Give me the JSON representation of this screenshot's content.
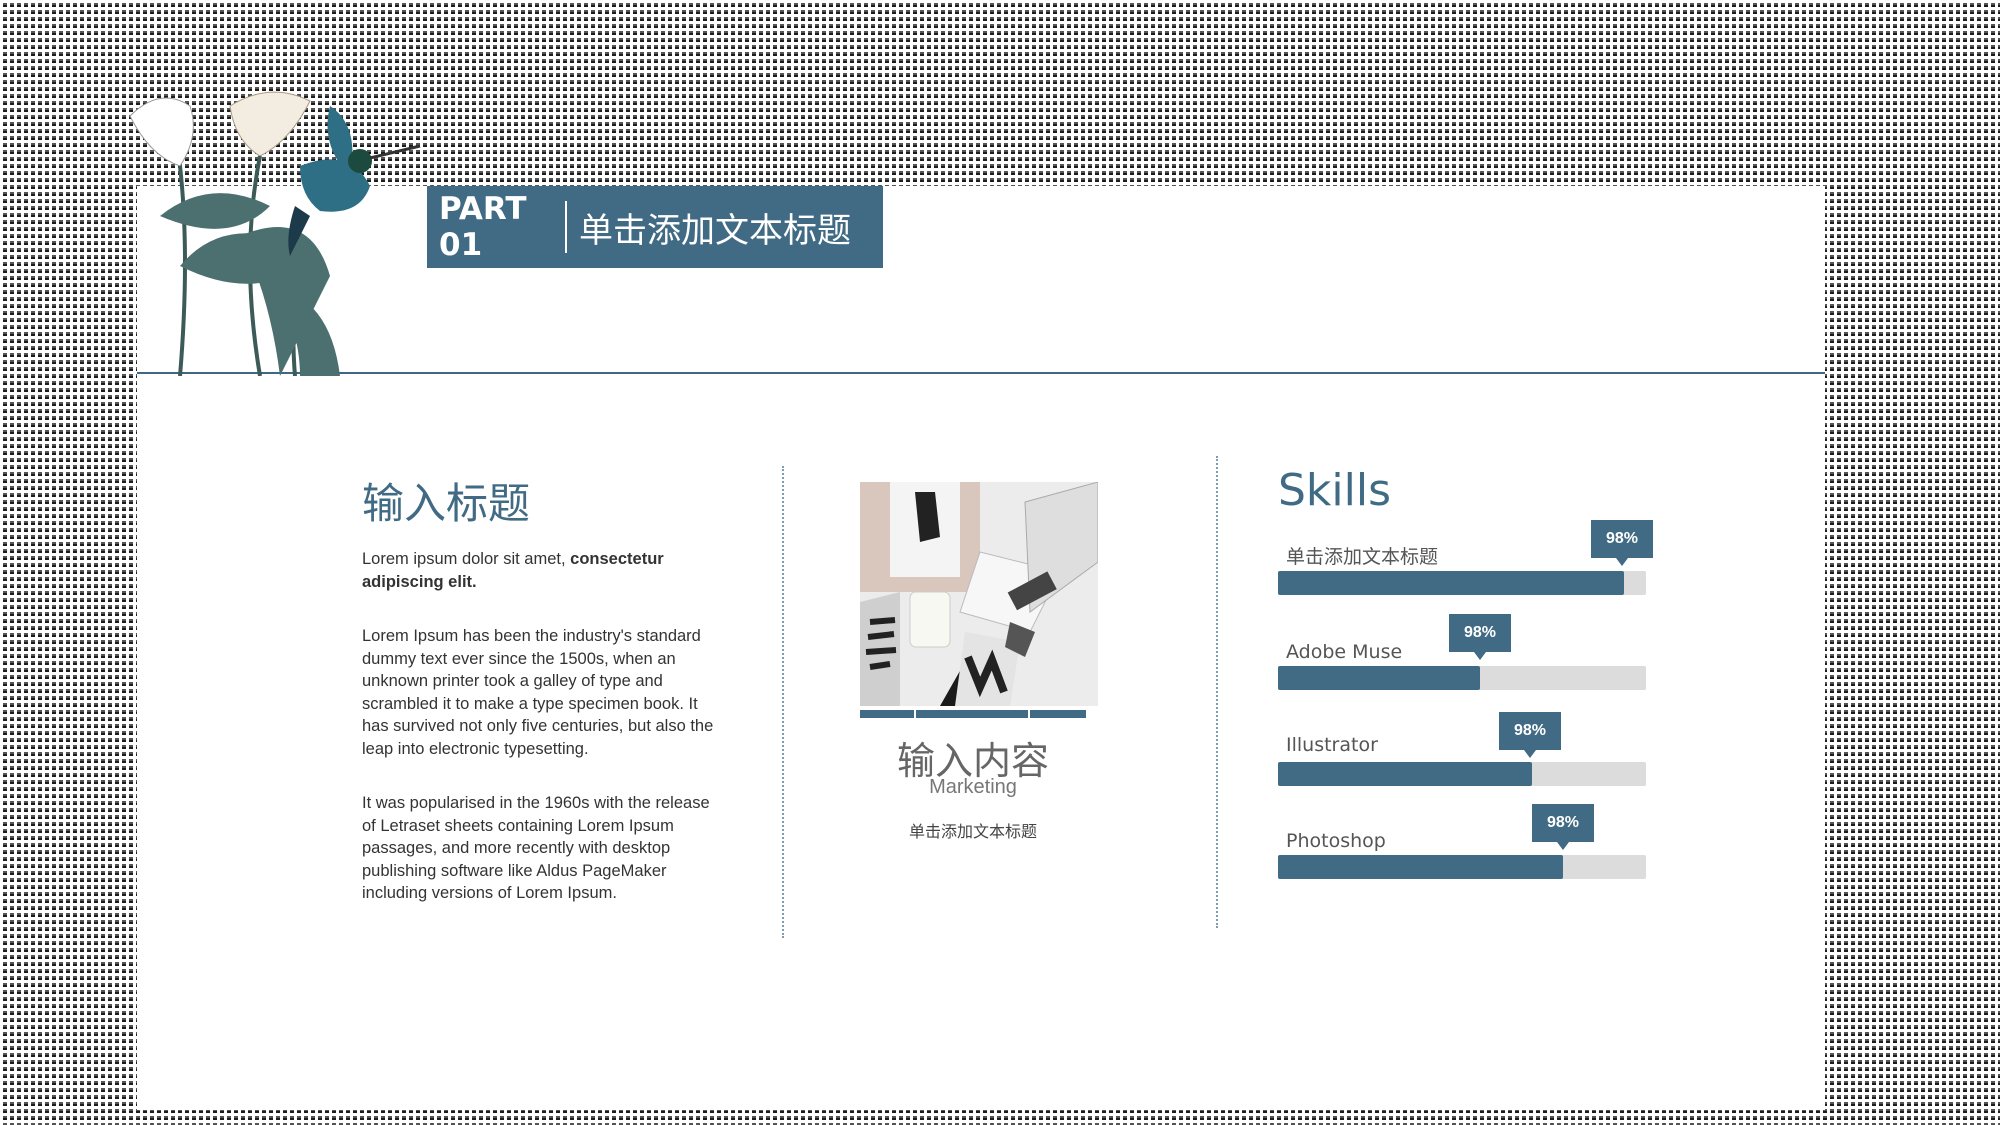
{
  "header": {
    "part_label": "PART 01",
    "title": "单击添加文本标题"
  },
  "left": {
    "title": "输入标题",
    "intro_plain": "Lorem ipsum dolor sit amet, ",
    "intro_bold": "consectetur adipiscing elit.",
    "para1": "Lorem Ipsum has been the industry's standard dummy text ever since the 1500s, when an unknown printer took a galley of type and scrambled it to make a type specimen book. It has survived not only five centuries, but also the leap into electronic typesetting.",
    "para2": "It was popularised in the 1960s with the release of Letraset sheets containing Lorem Ipsum passages, and more recently with desktop publishing software like Aldus PageMaker including versions of Lorem Ipsum."
  },
  "middle": {
    "title": "输入内容",
    "subtitle": "Marketing",
    "caption": "单击添加文本标题"
  },
  "skills": {
    "title": "Skills",
    "items": [
      {
        "label": "单击添加文本标题",
        "badge": "98%",
        "level": 0.94
      },
      {
        "label": "Adobe Muse",
        "badge": "98%",
        "level": 0.55
      },
      {
        "label": "Illustrator",
        "badge": "98%",
        "level": 0.69
      },
      {
        "label": "Photoshop",
        "badge": "98%",
        "level": 0.775
      }
    ]
  },
  "colors": {
    "accent": "#416a84",
    "track": "#dcdcdc"
  }
}
